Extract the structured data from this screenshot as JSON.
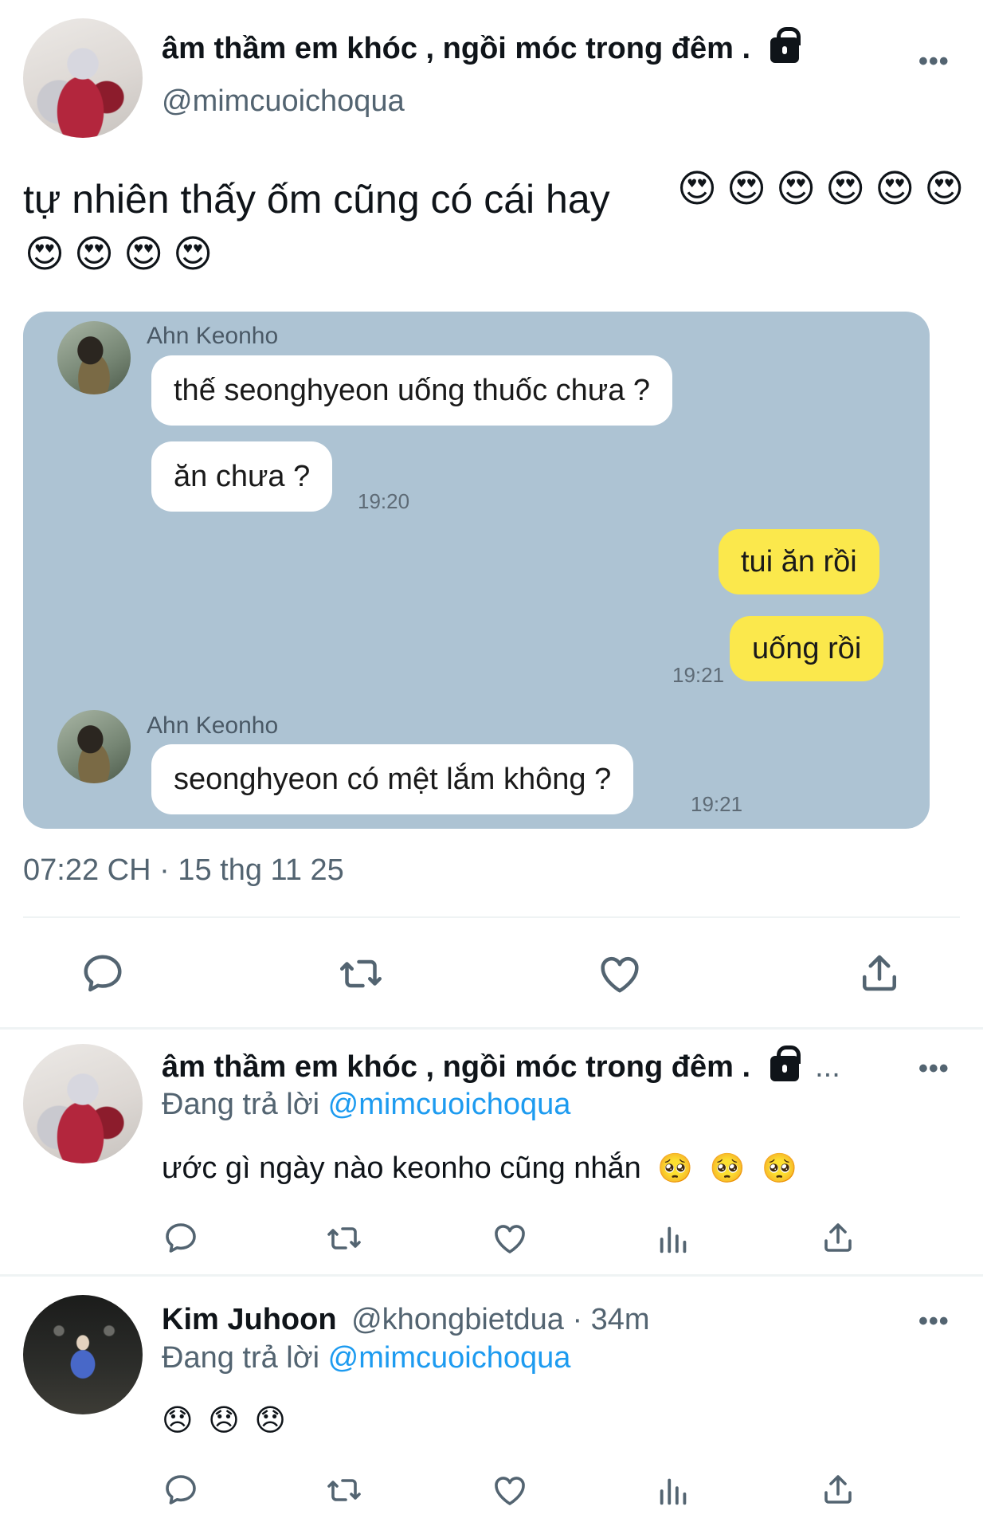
{
  "main_tweet": {
    "display_name": "âm thầm em khóc , ngồi móc trong đêm .",
    "handle": "@mimcuoichoqua",
    "more": "•••",
    "text": "tự nhiên thấy ốm cũng có cái hay",
    "emojis": [
      "😍",
      "😍",
      "😍",
      "😍",
      "😍",
      "😍",
      "😍",
      "😍",
      "😍",
      "😍"
    ],
    "timestamp": "07:22 CH · 15 thg 11 25"
  },
  "chat": {
    "sender_name": "Ahn Keonho",
    "messages": [
      {
        "text": "thế seonghyeon uống thuốc chưa ?",
        "side": "left"
      },
      {
        "text": "ăn chưa ?",
        "side": "left",
        "time": "19:20"
      },
      {
        "text": "tui ăn rồi",
        "side": "right"
      },
      {
        "text": "uống rồi",
        "side": "right",
        "time": "19:21"
      },
      {
        "text": "seonghyeon có mệt lắm không ?",
        "side": "left",
        "time": "19:21"
      }
    ]
  },
  "reply1": {
    "display_name": "âm thầm em khóc , ngồi móc trong đêm .",
    "ellipsis": "...",
    "replying_prefix": "Đang trả lời",
    "replying_to": "@mimcuoichoqua",
    "text": "ước gì ngày nào keonho cũng nhắn",
    "emojis": [
      "🥺",
      "🥺",
      "🥺"
    ],
    "more": "•••"
  },
  "reply2": {
    "display_name": "Kim Juhoon",
    "handle_time": "@khongbietdua · 34m",
    "replying_prefix": "Đang trả lời",
    "replying_to": "@mimcuoichoqua",
    "emojis": [
      "😞",
      "😞",
      "😞"
    ],
    "more": "•••"
  },
  "icons": [
    "reply-icon",
    "retweet-icon",
    "like-icon",
    "views-icon",
    "share-icon",
    "lock-icon"
  ],
  "colors": {
    "link": "#1d9bf0",
    "secondary_text": "#536471",
    "chat_background": "#adc3d3",
    "bubble_yellow": "#fbe84c"
  }
}
